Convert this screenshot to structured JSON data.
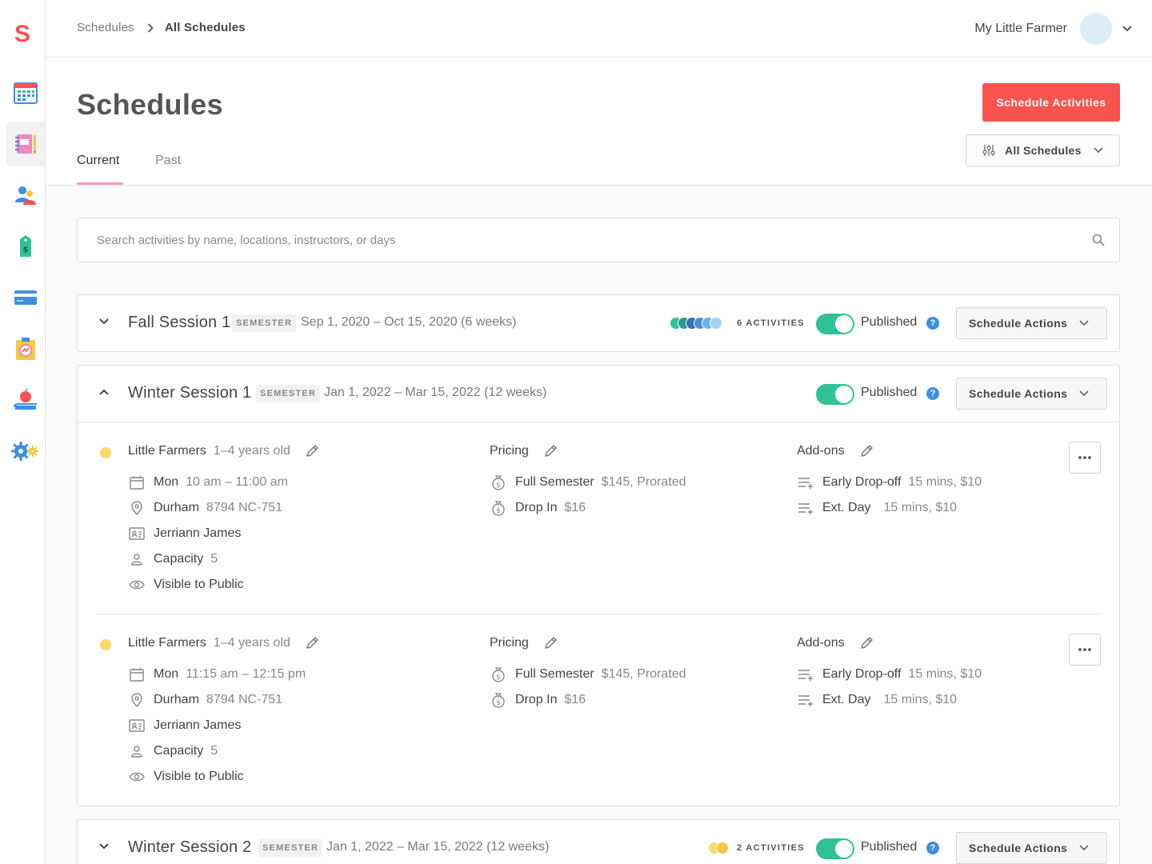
{
  "app": {
    "logo": "S"
  },
  "breadcrumbs": [
    "Schedules",
    "All Schedules"
  ],
  "user": {
    "name": "My Little Farmer"
  },
  "page": {
    "title": "Schedules",
    "primary_action": "Schedule Activities",
    "filter_label": "All Schedules"
  },
  "tabs": [
    {
      "label": "Current",
      "active": true
    },
    {
      "label": "Past",
      "active": false
    }
  ],
  "search": {
    "placeholder": "Search activities by name, locations, instructors, or days"
  },
  "colors": {
    "accent": "#f9534f",
    "toggle_on": "#2fc296",
    "help": "#3d8fe0",
    "tab_underline": "#e8a0c4"
  },
  "sidebar": {
    "items": [
      {
        "icon": "calendar-icon",
        "active": false
      },
      {
        "icon": "notebook-icon",
        "active": true
      },
      {
        "icon": "people-icon",
        "active": false
      },
      {
        "icon": "price-tag-icon",
        "active": false
      },
      {
        "icon": "credit-card-icon",
        "active": false
      },
      {
        "icon": "clipboard-chart-icon",
        "active": false
      },
      {
        "icon": "apple-book-icon",
        "active": false
      },
      {
        "icon": "gears-icon",
        "active": false
      }
    ]
  },
  "sessions": [
    {
      "name": "Fall Session 1",
      "badge": "SEMESTER",
      "dates": "Sep 1, 2020 – Oct 15, 2020 (6 weeks)",
      "expanded": false,
      "activity_count": "6 ACTIVITIES",
      "activity_colors": [
        "#2fc296",
        "#2a9d8f",
        "#3b6fb6",
        "#4a8fd8",
        "#6fb3ea",
        "#9fd3f2"
      ],
      "status": "Published",
      "actions_label": "Schedule Actions"
    },
    {
      "name": "Winter Session 1",
      "badge": "SEMESTER",
      "dates": "Jan 1, 2022 – Mar 15, 2022 (12 weeks)",
      "expanded": true,
      "status": "Published",
      "actions_label": "Schedule Actions",
      "activities": [
        {
          "name": "Little Farmers",
          "age": "1–4 years old",
          "day": "Mon",
          "time": "10 am – 11:00 am",
          "location": "Durham",
          "address": "8794 NC-751",
          "instructor": "Jerriann James",
          "capacity_label": "Capacity",
          "capacity": "5",
          "visibility": "Visible to Public",
          "pricing_title": "Pricing",
          "pricing": [
            {
              "name": "Full Semester",
              "detail": "$145, Prorated"
            },
            {
              "name": "Drop In",
              "detail": "$16"
            }
          ],
          "addons_title": "Add-ons",
          "addons": [
            {
              "name": "Early Drop-off",
              "detail": "15 mins, $10"
            },
            {
              "name": "Ext. Day",
              "detail": "15 mins, $10"
            }
          ]
        },
        {
          "name": "Little Farmers",
          "age": "1–4 years old",
          "day": "Mon",
          "time": "11:15 am – 12:15 pm",
          "location": "Durham",
          "address": "8794 NC-751",
          "instructor": "Jerriann James",
          "capacity_label": "Capacity",
          "capacity": "5",
          "visibility": "Visible to Public",
          "pricing_title": "Pricing",
          "pricing": [
            {
              "name": "Full Semester",
              "detail": "$145, Prorated"
            },
            {
              "name": "Drop In",
              "detail": "$16"
            }
          ],
          "addons_title": "Add-ons",
          "addons": [
            {
              "name": "Early Drop-off",
              "detail": "15 mins, $10"
            },
            {
              "name": "Ext. Day",
              "detail": "15 mins, $10"
            }
          ]
        }
      ]
    },
    {
      "name": "Winter Session 2",
      "badge": "SEMESTER",
      "dates": "Jan 1, 2022 – Mar 15, 2022 (12 weeks)",
      "expanded": false,
      "activity_count": "2 ACTIVITIES",
      "activity_colors": [
        "#fbd86a",
        "#f5c842"
      ],
      "status": "Published",
      "actions_label": "Schedule Actions"
    }
  ]
}
